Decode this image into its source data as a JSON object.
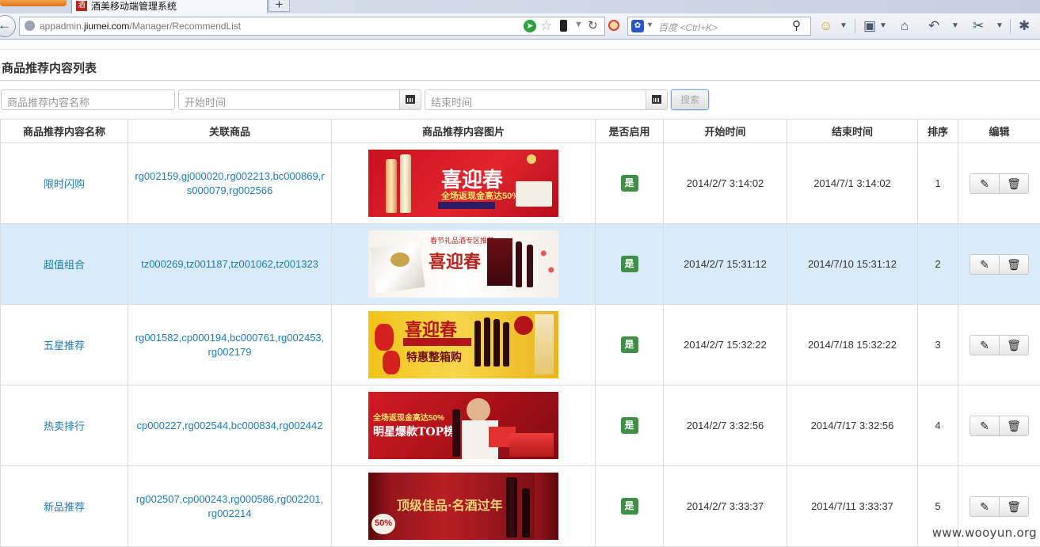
{
  "browser": {
    "tab_title": "酒美移动端管理系统",
    "tab_favicon_text": "酒",
    "new_tab": "+",
    "url_prefix": "appadmin.",
    "url_domain": "jiumei.com",
    "url_path": "/Manager/RecommendList",
    "search_placeholder": "百度 <Ctrl+K>"
  },
  "page": {
    "title": "商品推荐内容列表"
  },
  "filters": {
    "name_placeholder": "商品推荐内容名称",
    "start_placeholder": "开始时间",
    "end_placeholder": "结束时间",
    "search_label": "搜索"
  },
  "table": {
    "headers": [
      "商品推荐内容名称",
      "关联商品",
      "商品推荐内容图片",
      "是否启用",
      "开始时间",
      "结束时间",
      "排序",
      "编辑"
    ],
    "rows": [
      {
        "name": "限时闪购",
        "goods": "rg002159,gj000020,rg002213,bc000869,rs000079,rg002566",
        "enabled": "是",
        "start": "2014/2/7 3:14:02",
        "end": "2014/7/1 3:14:02",
        "order": "1",
        "banner": {
          "headline": "喜迎春",
          "sub": "全场返现金高达50%"
        }
      },
      {
        "name": "超值组合",
        "goods": "tz000269,tz001187,tz001062,tz001323",
        "enabled": "是",
        "start": "2014/2/7 15:31:12",
        "end": "2014/7/10 15:31:12",
        "order": "2",
        "banner": {
          "headline": "喜迎春",
          "sub": "春节礼品酒专区推荐"
        }
      },
      {
        "name": "五星推荐",
        "goods": "rg001582,cp000194,bc000761,rg002453,rg002179",
        "enabled": "是",
        "start": "2014/2/7 15:32:22",
        "end": "2014/7/18 15:32:22",
        "order": "3",
        "banner": {
          "headline": "喜迎春",
          "sub": "特惠整箱购"
        }
      },
      {
        "name": "热卖排行",
        "goods": "cp000227,rg002544,bc000834,rg002442",
        "enabled": "是",
        "start": "2014/2/7 3:32:56",
        "end": "2014/7/17 3:32:56",
        "order": "4",
        "banner": {
          "headline": "明星爆款TOP榜",
          "sub": "全场返现金高达50%"
        }
      },
      {
        "name": "新品推荐",
        "goods": "rg002507,cp000243,rg000586,rg002201,rg002214",
        "enabled": "是",
        "start": "2014/2/7 3:33:37",
        "end": "2014/7/11 3:33:37",
        "order": "5",
        "banner": {
          "headline": "顶级佳品·名酒过年",
          "sub": "50%"
        }
      }
    ]
  },
  "icons": {
    "edit": "pencil-icon",
    "delete": "trash-icon",
    "calendar": "calendar-icon"
  },
  "colors": {
    "link": "#1f7bb6",
    "badge": "#3f8f47",
    "highlight_row": "#d9eaf8"
  },
  "watermark": "www.wooyun.org"
}
